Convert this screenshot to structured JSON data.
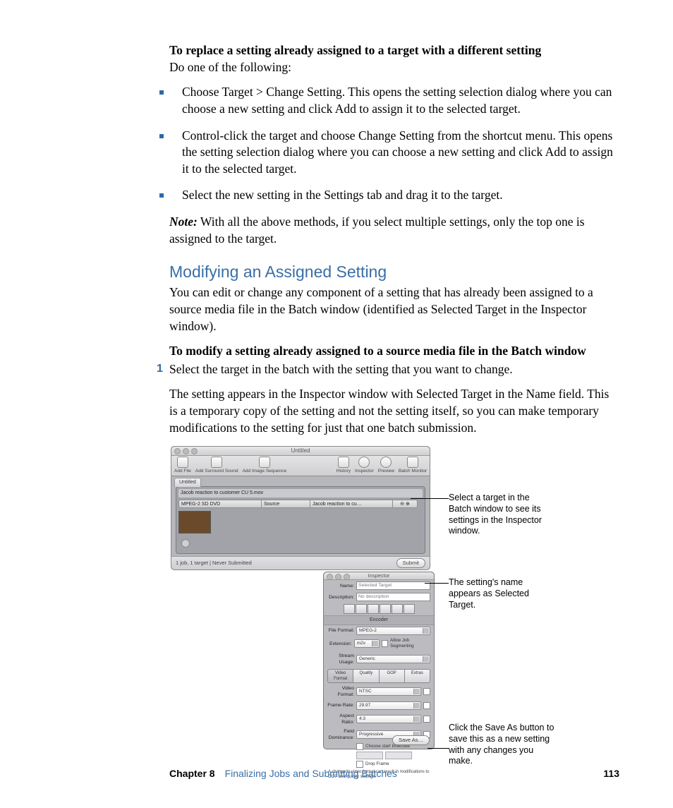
{
  "intro": {
    "heading": "To replace a setting already assigned to a target with a different setting",
    "sub": "Do one of the following:"
  },
  "bullets": [
    "Choose Target > Change Setting. This opens the setting selection dialog where you can choose a new setting and click Add to assign it to the selected target.",
    "Control-click the target and choose Change Setting from the shortcut menu. This opens the setting selection dialog where you can choose a new setting and click Add to assign it to the selected target.",
    "Select the new setting in the Settings tab and drag it to the target."
  ],
  "note": {
    "label": "Note:",
    "text": "  With all the above methods, if you select multiple settings, only the top one is assigned to the target."
  },
  "section": {
    "heading": "Modifying an Assigned Setting",
    "para1": "You can edit or change any component of a setting that has already been assigned to a source media file in the Batch window (identified as Selected Target in the Inspector window).",
    "task_heading": "To modify a setting already assigned to a source media file in the Batch window",
    "step1_num": "1",
    "step1": "Select the target in the batch with the setting that you want to change.",
    "para2": "The setting appears in the Inspector window with Selected Target in the Name field. This is a temporary copy of the setting and not the setting itself, so you can make temporary modifications to the setting for just that one batch submission."
  },
  "batch": {
    "title": "Untitled",
    "toolbar": {
      "addFile": "Add File",
      "addSurround": "Add Surround Sound",
      "addImage": "Add Image Sequence",
      "history": "History",
      "inspector": "Inspector",
      "preview": "Preview",
      "monitor": "Batch Monitor"
    },
    "tab": "Untitled",
    "jobName": "Jacob reaction to customer CU 5.mov",
    "cells": {
      "a": "MPEG-2 SD DVD",
      "b": "Source",
      "c": "Jacob reaction to cu…",
      "d": "⊖ ⊕"
    },
    "status": "1 job, 1 target  |  Never Submitted",
    "submit": "Submit"
  },
  "inspector": {
    "title": "Inspector",
    "name_label": "Name:",
    "name_value": "Selected Target",
    "desc_label": "Description:",
    "desc_value": "No description",
    "encoder": "Encoder",
    "fileFormat_label": "File Format:",
    "fileFormat": "MPEG-2",
    "extension_label": "Extension:",
    "extension": "m2v",
    "allowSeg": "Allow Job Segmenting",
    "streamUsage_label": "Stream Usage:",
    "streamUsage": "Generic",
    "tabs": {
      "a": "Video Format",
      "b": "Quality",
      "c": "GOP",
      "d": "Extras"
    },
    "videoFormat_label": "Video Format:",
    "videoFormat": "NTSC",
    "frameRate_label": "Frame Rate:",
    "frameRate": "29.97",
    "aspect_label": "Aspect Ratio:",
    "aspect": "4:3",
    "field_label": "Field Dominance:",
    "field": "Progressive",
    "chooseStart": "Choose start timecode",
    "dropFrame": "Drop Frame",
    "warn": "A change in video format can result in modifications to GOP and quality settings.",
    "saveAs": "Save As…"
  },
  "callouts": {
    "c1": "Select a target in the Batch window to see its settings in the Inspector window.",
    "c2": "The setting's name appears as Selected Target.",
    "c3": "Click the Save As button to save this as a new setting with any changes you make."
  },
  "footer": {
    "chapter": "Chapter 8",
    "title": "Finalizing Jobs and Submitting Batches",
    "page": "113"
  }
}
